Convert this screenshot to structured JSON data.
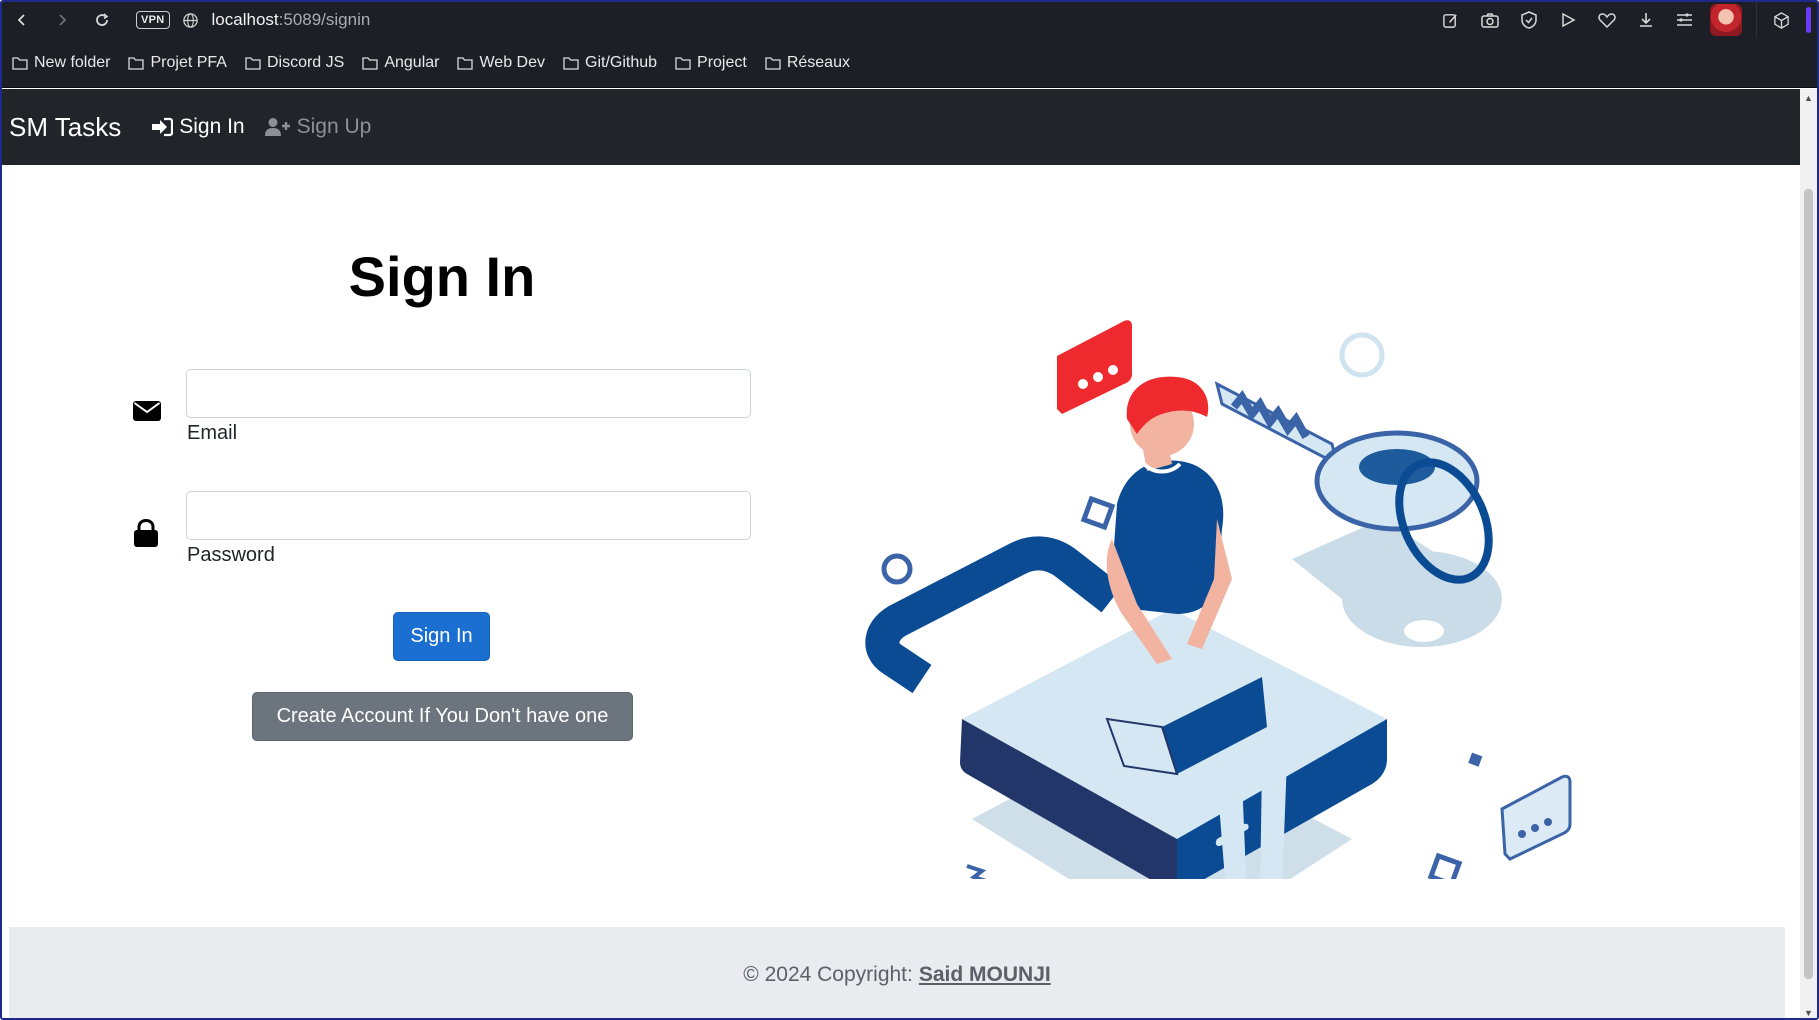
{
  "browser": {
    "vpn_label": "VPN",
    "url_host": "localhost",
    "url_path": ":5089/signin",
    "bookmarks": [
      {
        "label": "New folder"
      },
      {
        "label": "Projet PFA"
      },
      {
        "label": "Discord JS"
      },
      {
        "label": "Angular"
      },
      {
        "label": "Web Dev"
      },
      {
        "label": "Git/Github"
      },
      {
        "label": "Project"
      },
      {
        "label": "Réseaux"
      }
    ]
  },
  "navbar": {
    "brand": "SM Tasks",
    "signin_label": "Sign In",
    "signup_label": "Sign Up"
  },
  "form": {
    "title": "Sign In",
    "email_label": "Email",
    "email_value": "",
    "password_label": "Password",
    "password_value": "",
    "submit_label": "Sign In",
    "create_label": "Create Account If You Don't have one"
  },
  "footer": {
    "copyright": "© 2024 Copyright:",
    "author": "Said MOUNJI"
  },
  "colors": {
    "navbar_bg": "#212529",
    "primary": "#1a6fd1",
    "secondary": "#6c757d",
    "illustration_blue": "#0a4b94",
    "illustration_light": "#d5e7f2",
    "illustration_red": "#ee2a2e"
  }
}
